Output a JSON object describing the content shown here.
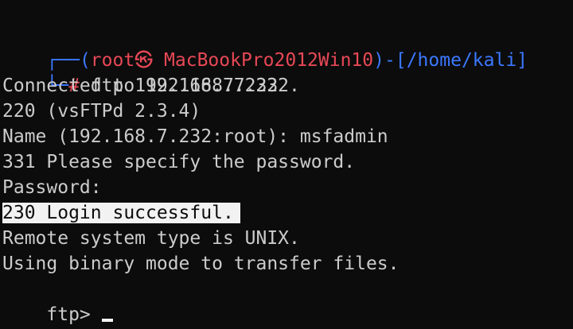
{
  "prompt": {
    "corner_top": "┌──",
    "open_paren": "(",
    "user_host": "root㉿ MacBookPro2012Win10",
    "close_paren": ")",
    "dash": "-",
    "path": "[/home/kali]",
    "corner_bottom": "└─",
    "hash": "#",
    "command": " ftp 192.168.7.232"
  },
  "output": [
    "Connected to 192.168.7.232.",
    "220 (vsFTPd 2.3.4)",
    "Name (192.168.7.232:root): msfadmin",
    "331 Please specify the password.",
    "Password:",
    "230 Login successful.",
    "Remote system type is UNIX.",
    "Using binary mode to transfer files."
  ],
  "ftp_prompt": "ftp>",
  "colors": {
    "background": "#0c0c0c",
    "text": "#cccccc",
    "prompt_blue": "#3b78ff",
    "prompt_red": "#e74856",
    "highlight_bg": "#f2f2f2"
  }
}
